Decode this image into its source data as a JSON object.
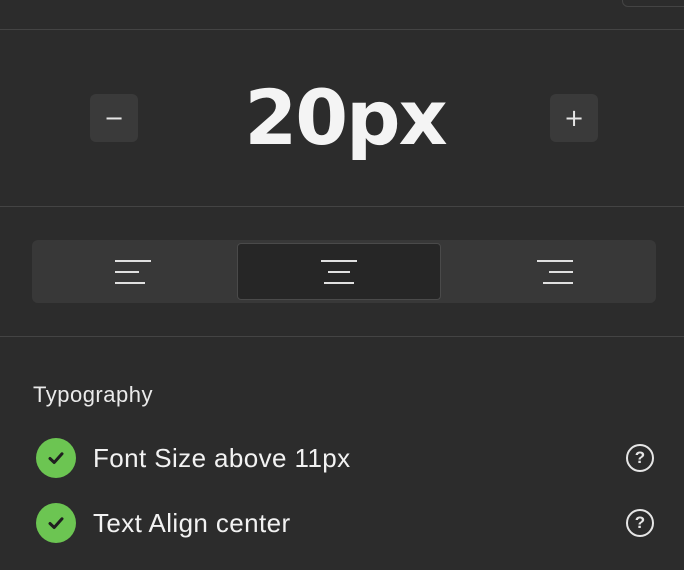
{
  "font_size": {
    "value": "20px",
    "decrement_label": "−",
    "increment_label": "+"
  },
  "text_align": {
    "options": [
      {
        "name": "left",
        "icon": "align-left-icon"
      },
      {
        "name": "center",
        "icon": "align-center-icon"
      },
      {
        "name": "right",
        "icon": "align-right-icon"
      }
    ],
    "selected": "center"
  },
  "typography": {
    "title": "Typography",
    "checks": [
      {
        "label": "Font Size above 11px",
        "status": "pass",
        "help": "?"
      },
      {
        "label": "Text Align center",
        "status": "pass",
        "help": "?"
      }
    ]
  },
  "colors": {
    "background": "#2c2c2c",
    "pass_green": "#6cc552",
    "button": "#3a3a3a",
    "segment_track": "#383838",
    "segment_active": "#262626"
  }
}
